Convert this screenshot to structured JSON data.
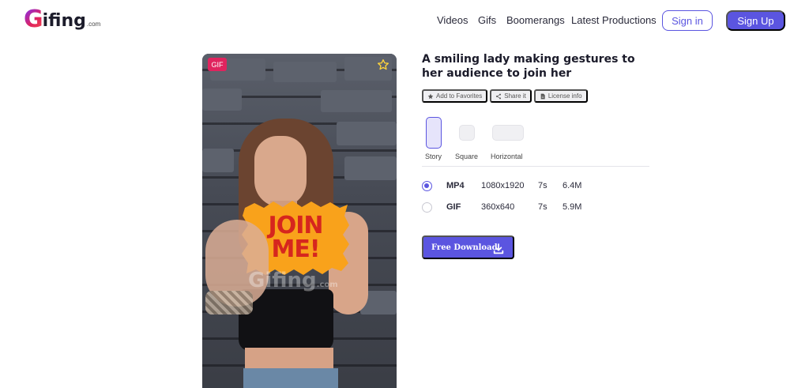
{
  "header": {
    "logo": {
      "brand": "Gifing",
      "letter": "G",
      "rest": "ifing",
      "suffix": ".com"
    },
    "nav": [
      "Videos",
      "Gifs",
      "Boomerangs",
      "Latest Productions"
    ],
    "signin_label": "Sign in",
    "signup_label": "Sign Up"
  },
  "media": {
    "badge": "GIF",
    "sign_text_line1": "JOIN",
    "sign_text_line2": "ME!",
    "watermark": "Gifing",
    "watermark_suffix": ".com",
    "star_icon": "star-outline-icon"
  },
  "details": {
    "title": "A smiling lady making gestures to her audience to join her",
    "actions": [
      {
        "label": "Add to Favorites",
        "icon": "star-icon"
      },
      {
        "label": "Share it",
        "icon": "share-icon"
      },
      {
        "label": "License info",
        "icon": "document-icon"
      }
    ],
    "formats": [
      {
        "label": "Story",
        "selected": true
      },
      {
        "label": "Square",
        "selected": false
      },
      {
        "label": "Horizontal",
        "selected": false
      }
    ],
    "options": [
      {
        "format": "MP4",
        "resolution": "1080x1920",
        "duration": "7s",
        "size": "6.4M",
        "selected": true
      },
      {
        "format": "GIF",
        "resolution": "360x640",
        "duration": "7s",
        "size": "5.9M",
        "selected": false
      }
    ],
    "download_label": "Free Download",
    "download_icon": "download-icon"
  },
  "colors": {
    "accent": "#5b55e0",
    "badge": "#e0245e",
    "sign": "#f9a21b"
  }
}
